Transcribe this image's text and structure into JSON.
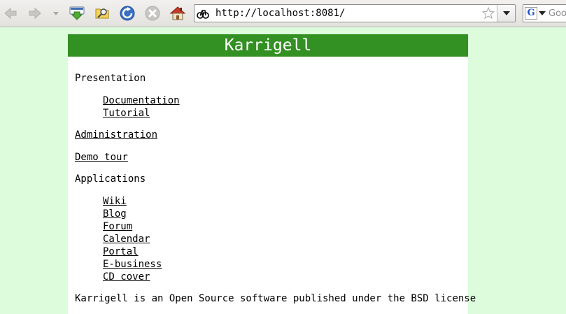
{
  "browser": {
    "url": "http://localhost:8081/",
    "search_placeholder": "Google",
    "search_engine_glyph": "G"
  },
  "page": {
    "banner_title": "Karrigell",
    "banner_color": "#339022",
    "background_color": "#dcfcdc",
    "presentation": {
      "label": "Presentation",
      "links": [
        "Documentation",
        "Tutorial"
      ]
    },
    "administration": "Administration",
    "demo_tour": "Demo tour",
    "applications": {
      "label": "Applications",
      "links": [
        "Wiki",
        "Blog",
        "Forum",
        "Calendar",
        "Portal",
        "E-business",
        "CD cover"
      ]
    },
    "footer_text": "Karrigell is an Open Source software published under the BSD license"
  }
}
